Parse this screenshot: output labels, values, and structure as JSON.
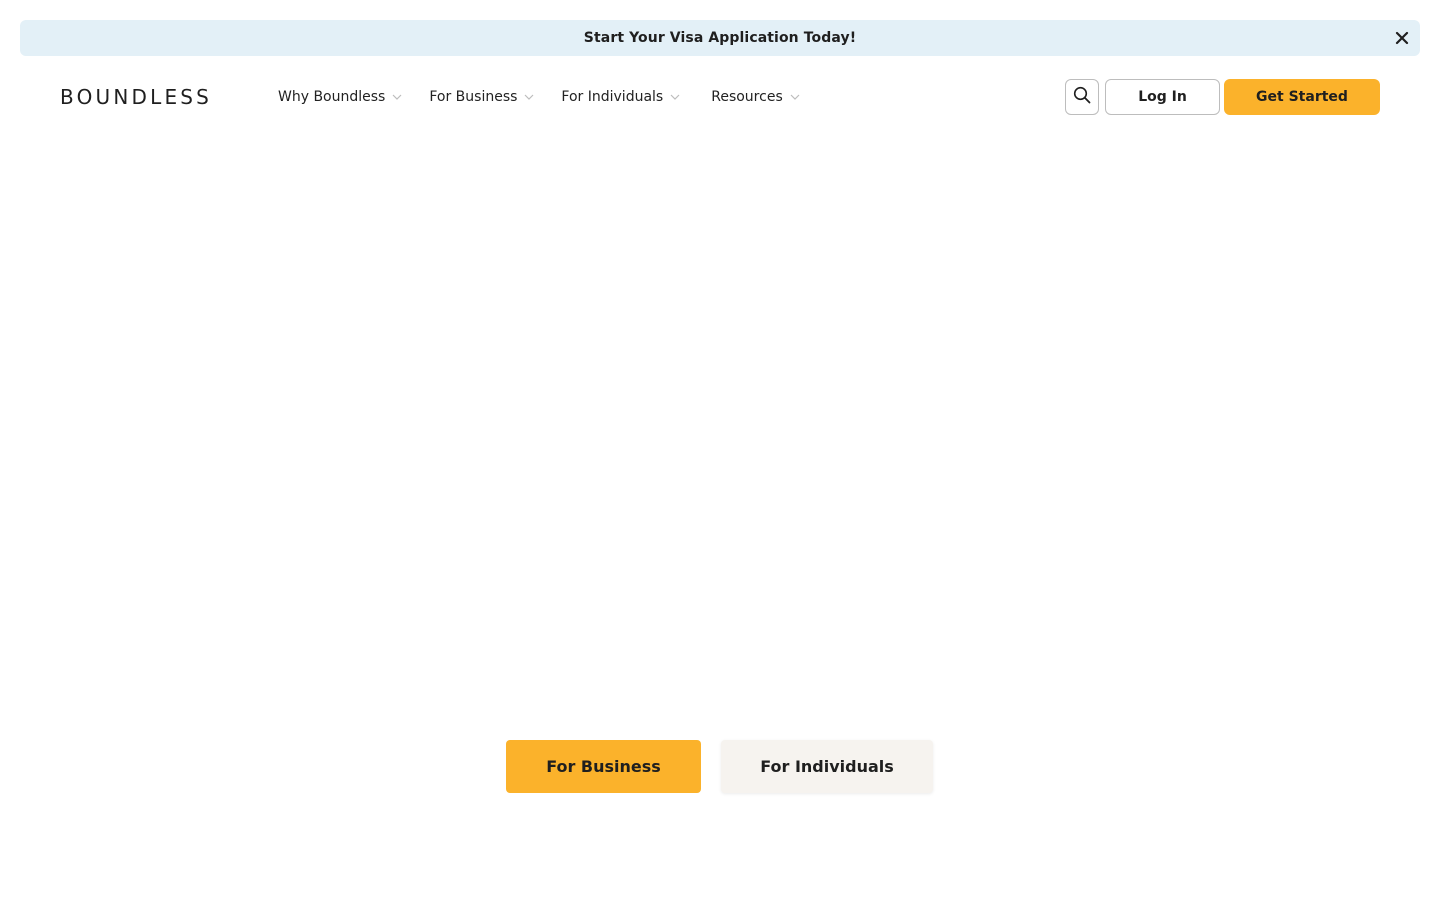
{
  "banner": {
    "text": "Start Your Visa Application Today!",
    "close_icon": "close-icon",
    "background": "#e3f0f7"
  },
  "header": {
    "logo": "BOUNDLESS",
    "nav": [
      {
        "label": "Why Boundless",
        "icon": "chevron-down-icon"
      },
      {
        "label": "For Business",
        "icon": "chevron-down-icon"
      },
      {
        "label": "For Individuals",
        "icon": "chevron-down-icon"
      },
      {
        "label": "Resources",
        "icon": "chevron-down-icon"
      }
    ],
    "search_icon": "search-icon",
    "login_label": "Log In",
    "get_started_label": "Get Started",
    "accent": "#fbb22b"
  },
  "audience": {
    "business_label": "For Business",
    "individuals_label": "For Individuals"
  }
}
